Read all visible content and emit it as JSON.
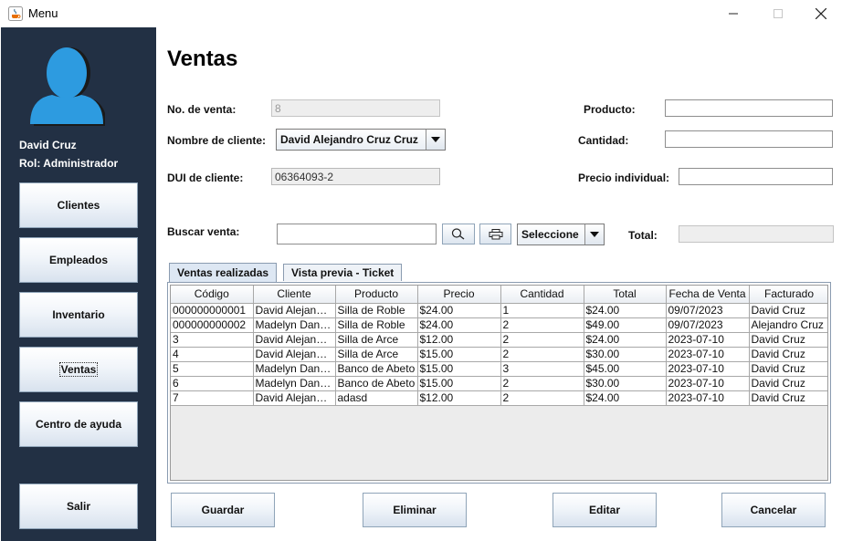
{
  "window": {
    "title": "Menu"
  },
  "sidebar": {
    "user_name": "David Cruz",
    "user_role": "Rol: Administrador",
    "buttons": [
      {
        "label": "Clientes"
      },
      {
        "label": "Empleados"
      },
      {
        "label": "Inventario"
      },
      {
        "label": "Ventas",
        "active": true
      },
      {
        "label": "Centro de ayuda"
      },
      {
        "label": "Salir"
      }
    ]
  },
  "form": {
    "title": "Ventas",
    "no_venta_label": "No. de venta:",
    "no_venta_value": "8",
    "nombre_cliente_label": "Nombre de cliente:",
    "nombre_cliente_value": "David Alejandro Cruz Cruz",
    "dui_label": "DUI de cliente:",
    "dui_value": "06364093-2",
    "producto_label": "Producto:",
    "producto_value": "",
    "cantidad_label": "Cantidad:",
    "cantidad_value": "",
    "precio_label": "Precio individual:",
    "precio_value": "",
    "buscar_label": "Buscar venta:",
    "buscar_value": "",
    "filtro_value": "Seleccione",
    "total_label": "Total:",
    "total_value": ""
  },
  "tabs": [
    {
      "label": "Ventas realizadas",
      "active": true
    },
    {
      "label": "Vista previa - Ticket",
      "active": false
    }
  ],
  "table": {
    "columns": [
      "Código",
      "Cliente",
      "Producto",
      "Precio",
      "Cantidad",
      "Total",
      "Fecha de Venta",
      "Facturado"
    ],
    "rows": [
      [
        "000000000001",
        "David Alejandro Cruz Cruz",
        "Silla de Roble",
        "$24.00",
        "1",
        "$24.00",
        "09/07/2023",
        "David Cruz"
      ],
      [
        "000000000002",
        "Madelyn Daniela Reyes",
        "Silla de Roble",
        "$24.00",
        "2",
        "$49.00",
        "09/07/2023",
        "Alejandro Cruz"
      ],
      [
        "3",
        "David Alejandro Cruz Cruz",
        "Silla de Arce",
        "$12.00",
        "2",
        "$24.00",
        "2023-07-10",
        "David Cruz"
      ],
      [
        "4",
        "David Alejandro Cruz Cruz",
        "Silla de Arce",
        "$15.00",
        "2",
        "$30.00",
        "2023-07-10",
        "David Cruz"
      ],
      [
        "5",
        "Madelyn Daniela Reyes",
        "Banco de Abeto",
        "$15.00",
        "3",
        "$45.00",
        "2023-07-10",
        "David Cruz"
      ],
      [
        "6",
        "Madelyn Daniela Reyes",
        "Banco de Abeto",
        "$15.00",
        "2",
        "$30.00",
        "2023-07-10",
        "David Cruz"
      ],
      [
        "7",
        "David Alejandro Cruz Cruz",
        "adasd",
        "$12.00",
        "2",
        "$24.00",
        "2023-07-10",
        "David Cruz"
      ]
    ]
  },
  "actions": {
    "guardar": "Guardar",
    "eliminar": "Eliminar",
    "editar": "Editar",
    "cancelar": "Cancelar"
  },
  "colors": {
    "sidebar_bg": "#223044",
    "avatar_blue": "#2d9be0",
    "button_border": "#8fa4b8"
  }
}
